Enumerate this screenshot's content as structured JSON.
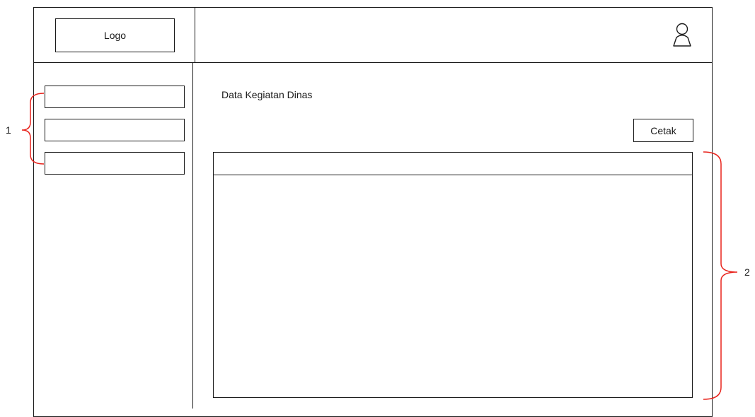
{
  "header": {
    "logo_label": "Logo",
    "user_icon": "user-icon"
  },
  "sidebar": {
    "items": [
      {
        "label": ""
      },
      {
        "label": ""
      },
      {
        "label": ""
      }
    ]
  },
  "main": {
    "title": "Data Kegiatan Dinas",
    "print_button": "Cetak",
    "table": {
      "columns": [],
      "rows": []
    }
  },
  "annotations": {
    "sidebar_marker": "1",
    "table_marker": "2",
    "color": "#e8231c"
  }
}
